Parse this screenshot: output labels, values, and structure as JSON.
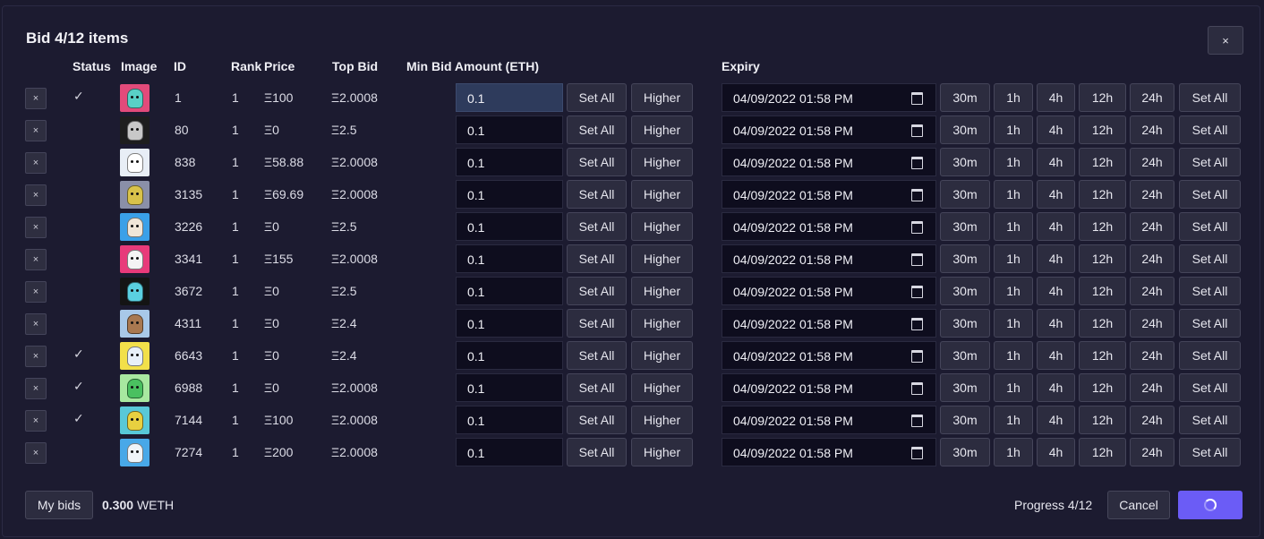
{
  "modal": {
    "title": "Bid 4/12 items",
    "close_label": "×"
  },
  "headers": {
    "status": "Status",
    "image": "Image",
    "id": "ID",
    "rank": "Rank",
    "price": "Price",
    "top_bid": "Top Bid",
    "min_bid": "Min Bid Amount (ETH)",
    "expiry": "Expiry"
  },
  "row_labels": {
    "remove": "×",
    "set_all": "Set All",
    "higher": "Higher",
    "presets": [
      "30m",
      "1h",
      "4h",
      "12h",
      "24h"
    ],
    "set_all_expiry": "Set All"
  },
  "rows": [
    {
      "status": "✓",
      "id": "1",
      "rank": "1",
      "price": "Ξ100",
      "top_bid": "Ξ2.0008",
      "min_bid": "0.1",
      "expiry": "04/09/2022 01:58 PM",
      "thumb_bg": "#e24a7a",
      "face_color": "#59d0c6",
      "focused": true
    },
    {
      "status": "",
      "id": "80",
      "rank": "1",
      "price": "Ξ0",
      "top_bid": "Ξ2.5",
      "min_bid": "0.1",
      "expiry": "04/09/2022 01:58 PM",
      "thumb_bg": "#1e1e1e",
      "face_color": "#c8c8c8",
      "focused": false
    },
    {
      "status": "",
      "id": "838",
      "rank": "1",
      "price": "Ξ58.88",
      "top_bid": "Ξ2.0008",
      "min_bid": "0.1",
      "expiry": "04/09/2022 01:58 PM",
      "thumb_bg": "#e8eef6",
      "face_color": "#ffffff",
      "focused": false
    },
    {
      "status": "",
      "id": "3135",
      "rank": "1",
      "price": "Ξ69.69",
      "top_bid": "Ξ2.0008",
      "min_bid": "0.1",
      "expiry": "04/09/2022 01:58 PM",
      "thumb_bg": "#8a8fa8",
      "face_color": "#d8c24a",
      "focused": false
    },
    {
      "status": "",
      "id": "3226",
      "rank": "1",
      "price": "Ξ0",
      "top_bid": "Ξ2.5",
      "min_bid": "0.1",
      "expiry": "04/09/2022 01:58 PM",
      "thumb_bg": "#3aa0e8",
      "face_color": "#f0e6d8",
      "focused": false
    },
    {
      "status": "",
      "id": "3341",
      "rank": "1",
      "price": "Ξ155",
      "top_bid": "Ξ2.0008",
      "min_bid": "0.1",
      "expiry": "04/09/2022 01:58 PM",
      "thumb_bg": "#e83a7a",
      "face_color": "#f4f4f4",
      "focused": false
    },
    {
      "status": "",
      "id": "3672",
      "rank": "1",
      "price": "Ξ0",
      "top_bid": "Ξ2.5",
      "min_bid": "0.1",
      "expiry": "04/09/2022 01:58 PM",
      "thumb_bg": "#141414",
      "face_color": "#5ad0e0",
      "focused": false
    },
    {
      "status": "",
      "id": "4311",
      "rank": "1",
      "price": "Ξ0",
      "top_bid": "Ξ2.4",
      "min_bid": "0.1",
      "expiry": "04/09/2022 01:58 PM",
      "thumb_bg": "#a8c8e8",
      "face_color": "#a87850",
      "focused": false
    },
    {
      "status": "✓",
      "id": "6643",
      "rank": "1",
      "price": "Ξ0",
      "top_bid": "Ξ2.4",
      "min_bid": "0.1",
      "expiry": "04/09/2022 01:58 PM",
      "thumb_bg": "#f2e04a",
      "face_color": "#e8f0f8",
      "focused": false
    },
    {
      "status": "✓",
      "id": "6988",
      "rank": "1",
      "price": "Ξ0",
      "top_bid": "Ξ2.0008",
      "min_bid": "0.1",
      "expiry": "04/09/2022 01:58 PM",
      "thumb_bg": "#a8e8a0",
      "face_color": "#4ac060",
      "focused": false
    },
    {
      "status": "✓",
      "id": "7144",
      "rank": "1",
      "price": "Ξ100",
      "top_bid": "Ξ2.0008",
      "min_bid": "0.1",
      "expiry": "04/09/2022 01:58 PM",
      "thumb_bg": "#58c8d8",
      "face_color": "#e8d040",
      "focused": false
    },
    {
      "status": "",
      "id": "7274",
      "rank": "1",
      "price": "Ξ200",
      "top_bid": "Ξ2.0008",
      "min_bid": "0.1",
      "expiry": "04/09/2022 01:58 PM",
      "thumb_bg": "#48a8e8",
      "face_color": "#f0f4f8",
      "focused": false
    }
  ],
  "footer": {
    "my_bids_label": "My bids",
    "total_amount": "0.300",
    "total_currency": "WETH",
    "progress_label": "Progress 4/12",
    "cancel_label": "Cancel",
    "submit_state": "loading-spinner"
  },
  "colors": {
    "accent": "#6b5cf6",
    "background": "#1c1b30",
    "input_bg": "#0e0d1e",
    "button_bg": "#2c2c3f"
  }
}
